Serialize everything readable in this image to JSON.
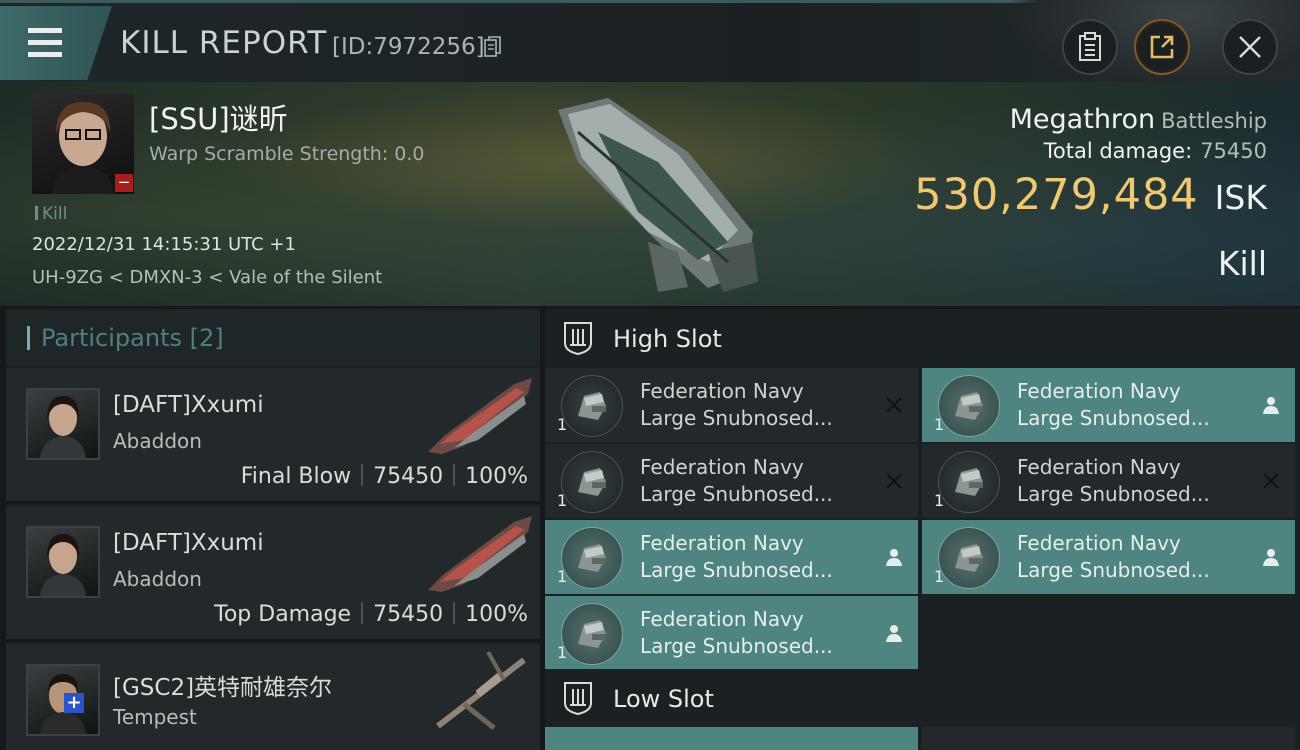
{
  "header": {
    "title": "KILL REPORT",
    "report_id": "[ID:7972256]"
  },
  "victim": {
    "name": "[SSU]谜昕",
    "warp_scramble": "Warp Scramble Strength: 0.0",
    "kill_tag": "Kill",
    "datetime": "2022/12/31 14:15:31 UTC +1",
    "location": "UH-9ZG < DMXN-3 < Vale of the Silent",
    "ship_name": "Megathron",
    "ship_class": "Battleship",
    "total_damage_label": "Total damage:",
    "total_damage": "75450",
    "isk_value": "530,279,484",
    "isk_unit": "ISK",
    "result": "Kill"
  },
  "participants": {
    "label": "Participants [2]",
    "items": [
      {
        "name": "[DAFT]Xxumi",
        "ship": "Abaddon",
        "role": "Final Blow",
        "damage": "75450",
        "percent": "100%"
      },
      {
        "name": "[DAFT]Xxumi",
        "ship": "Abaddon",
        "role": "Top Damage",
        "damage": "75450",
        "percent": "100%"
      },
      {
        "name": "[GSC2]英特耐雄奈尔",
        "ship": "Tempest"
      }
    ]
  },
  "fitting": {
    "high_slot_label": "High Slot",
    "low_slot_label": "Low Slot",
    "high_slot": [
      {
        "line1": "Federation Navy",
        "line2": "Large Snubnosed...",
        "qty": "1",
        "state": "destroyed"
      },
      {
        "line1": "Federation Navy",
        "line2": "Large Snubnosed...",
        "qty": "1",
        "state": "dropped"
      },
      {
        "line1": "Federation Navy",
        "line2": "Large Snubnosed...",
        "qty": "1",
        "state": "destroyed"
      },
      {
        "line1": "Federation Navy",
        "line2": "Large Snubnosed...",
        "qty": "1",
        "state": "destroyed"
      },
      {
        "line1": "Federation Navy",
        "line2": "Large Snubnosed...",
        "qty": "1",
        "state": "dropped"
      },
      {
        "line1": "Federation Navy",
        "line2": "Large Snubnosed...",
        "qty": "1",
        "state": "dropped"
      },
      {
        "line1": "Federation Navy",
        "line2": "Large Snubnosed...",
        "qty": "1",
        "state": "dropped"
      }
    ]
  },
  "colors": {
    "accent_teal": "#4e8580",
    "isk_gold": "#f0c871",
    "victim_badge": "#a81e1e",
    "plus_badge": "#2b55c4"
  },
  "icons": [
    "menu-icon",
    "copy-icon",
    "clipboard-icon",
    "share-icon",
    "close-icon",
    "slot-icon",
    "pilot-icon",
    "destroyed-x-icon"
  ]
}
